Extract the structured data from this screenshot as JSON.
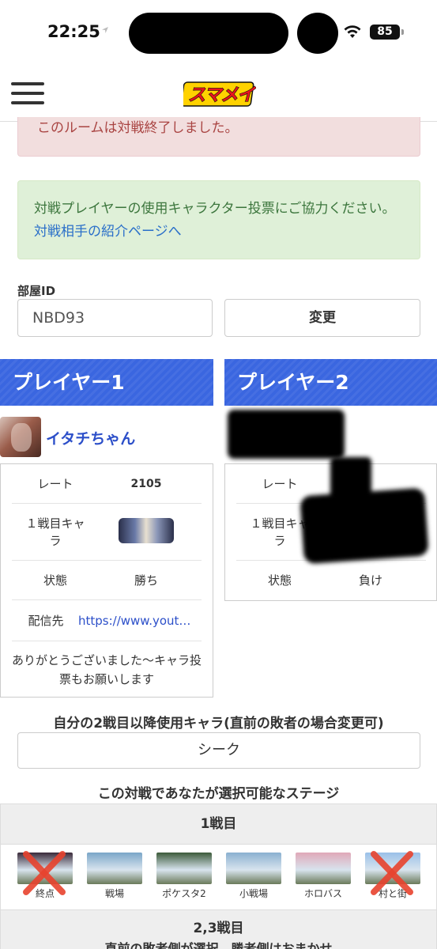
{
  "status_bar": {
    "time": "22:25",
    "battery": "85"
  },
  "header": {
    "logo_text": "スマメイト"
  },
  "alerts": {
    "ended": "このルームは対戦終了しました。",
    "vote_text": "対戦プレイヤーの使用キャラクター投票にご協力ください。",
    "vote_link": "対戦相手の紹介ページへ"
  },
  "room": {
    "label": "部屋ID",
    "value": "NBD93",
    "change_button": "変更"
  },
  "player1": {
    "header": "プレイヤー1",
    "name": "イタチちゃん",
    "rows": {
      "rate_label": "レート",
      "rate_value": "2105",
      "char_label": "１戦目キャラ",
      "state_label": "状態",
      "state_value": "勝ち",
      "stream_label": "配信先",
      "stream_value": "https://www.youtube.com/"
    },
    "message": "ありがとうございました〜キャラ投票もお願いします"
  },
  "player2": {
    "header": "プレイヤー2",
    "rows": {
      "rate_label": "レート",
      "char_label": "１戦目キャラ",
      "state_label": "状態",
      "state_value": "負け"
    }
  },
  "second_char": {
    "title": "自分の2戦目以降使用キャラ(直前の敗者の場合変更可)",
    "value": "シーク"
  },
  "stages": {
    "title": "この対戦であなたが選択可能なステージ",
    "round1": "1戦目",
    "items": [
      {
        "name": "終点",
        "struck": true,
        "color": "#3a2a3a"
      },
      {
        "name": "戦場",
        "struck": false,
        "color": "#7aa6c8"
      },
      {
        "name": "ポケスタ2",
        "struck": false,
        "color": "#3c5a3a"
      },
      {
        "name": "小戦場",
        "struck": false,
        "color": "#8ab0d0"
      },
      {
        "name": "ホロバス",
        "struck": false,
        "color": "#e0a8b8"
      },
      {
        "name": "村と街",
        "struck": true,
        "color": "#9ac0e8"
      }
    ],
    "round23": "2,3戦目",
    "round23_note": "直前の敗者側が選択、勝者側はおまかせ"
  }
}
